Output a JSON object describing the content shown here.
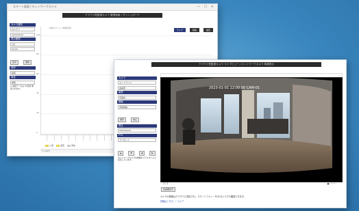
{
  "back_window": {
    "title": "スマート画面 / ネットワークカメラ",
    "system_bar": "クラウド型監視カメラ 管理画面 / ダッシュボード",
    "window_controls": "— ☐ ✕",
    "sidebar": {
      "sections": [
        {
          "header": "カメラ選択",
          "fields": [
            "カメラ 1",
            "2023/01/01"
          ]
        },
        {
          "header": "表示期間",
          "fields": [
            "1日",
            "09:00"
          ]
        },
        {
          "header": "操作",
          "fields": [
            "検索"
          ]
        },
        {
          "header": "設定",
          "fields": [
            "通知"
          ]
        }
      ],
      "buttons": [
        "表示",
        "更新"
      ],
      "note": "※ 録画データは 30日間 保存されます。"
    },
    "tabs": [
      "ライブ",
      "録画",
      "設定"
    ],
    "chart_caption": "人数カウント / 時間帯別",
    "y_ticks": [
      "100",
      "80",
      "60",
      "40",
      "20",
      "0"
    ],
    "legend": [
      "入室",
      "退室",
      "滞在"
    ],
    "footer": "© 2023"
  },
  "front_window": {
    "system_bar": "クラウド型監視カメラ ライブビュー / ネットワークカメラ 映像表示",
    "sidebar": {
      "sections": [
        {
          "header": "カメラ",
          "fields": [
            "エントランス",
            "会議室"
          ]
        },
        {
          "header": "画質",
          "fields": [
            "高画質"
          ]
        },
        {
          "header": "録画",
          "fields": [
            "手動録画"
          ]
        },
        {
          "header": "再生",
          "fields": [
            "2023/01/01"
          ]
        },
        {
          "header": "PTZ",
          "fields": [
            "プリセット"
          ]
        }
      ],
      "buttons": [
        "▲",
        "▼",
        "◀",
        "▶",
        "保存",
        "停止"
      ],
      "note": "ネットワークカメラの映像をリアルタイムで表示しています。"
    },
    "video_overlay": "2023-01-01 12:00:00  CAM-01",
    "video_caption": "1 / 1",
    "video_caption2": "■ ─────",
    "control_button": "全画面表示",
    "info_text": "カメラの映像はクラウドに保存され、スマートフォン・PCからいつでも確認できます。",
    "link_text": "詳細はこちら ／ ヘルプ"
  }
}
